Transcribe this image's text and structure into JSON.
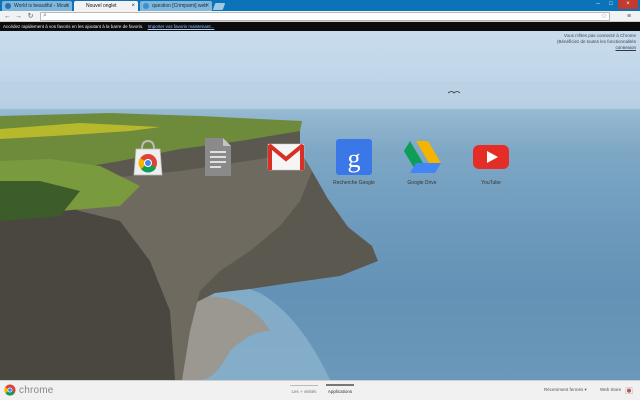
{
  "tabs": [
    {
      "label": "World is beautiful - Mous",
      "active": false
    },
    {
      "label": "Nouvel onglet",
      "active": true
    },
    {
      "label": "question [Crimpami] web",
      "active": false
    }
  ],
  "toolbar": {
    "url_value": "",
    "menu_icon": "hamburger-menu-icon",
    "star_icon": "star-icon",
    "back_icon": "back-arrow-icon",
    "forward_icon": "forward-arrow-icon",
    "reload_icon": "reload-icon"
  },
  "bookmarks_bar": {
    "text": "Accédez rapidement à vos favoris en les ajoutant à la barre de favoris.",
    "link": "Importer vos favoris maintenant..."
  },
  "signin": {
    "line1": "Vous n'êtes pas connecté à Chrome",
    "line2": "(Bénéficiez de toutes les fonctionnalités",
    "link": "connexion"
  },
  "apps": [
    {
      "name": "web-store-app",
      "label": ""
    },
    {
      "name": "docs-app",
      "label": ""
    },
    {
      "name": "gmail-app",
      "label": ""
    },
    {
      "name": "google-search-app",
      "label": "Recherche Google"
    },
    {
      "name": "google-drive-app",
      "label": "Google Drive"
    },
    {
      "name": "youtube-app",
      "label": "YouTube"
    }
  ],
  "bottom_bar": {
    "brand": "chrome",
    "pages": [
      {
        "label": "Les + visités",
        "active": false
      },
      {
        "label": "Applications",
        "active": true
      }
    ],
    "recent_label": "Récemment fermés",
    "webstore_label": "Web Store"
  },
  "colors": {
    "tabstrip": "#0b74b8",
    "active_tab": "#f2f2f2",
    "close_button": "#c23b2e",
    "bookmarks_bar": "#0c0c0c"
  }
}
